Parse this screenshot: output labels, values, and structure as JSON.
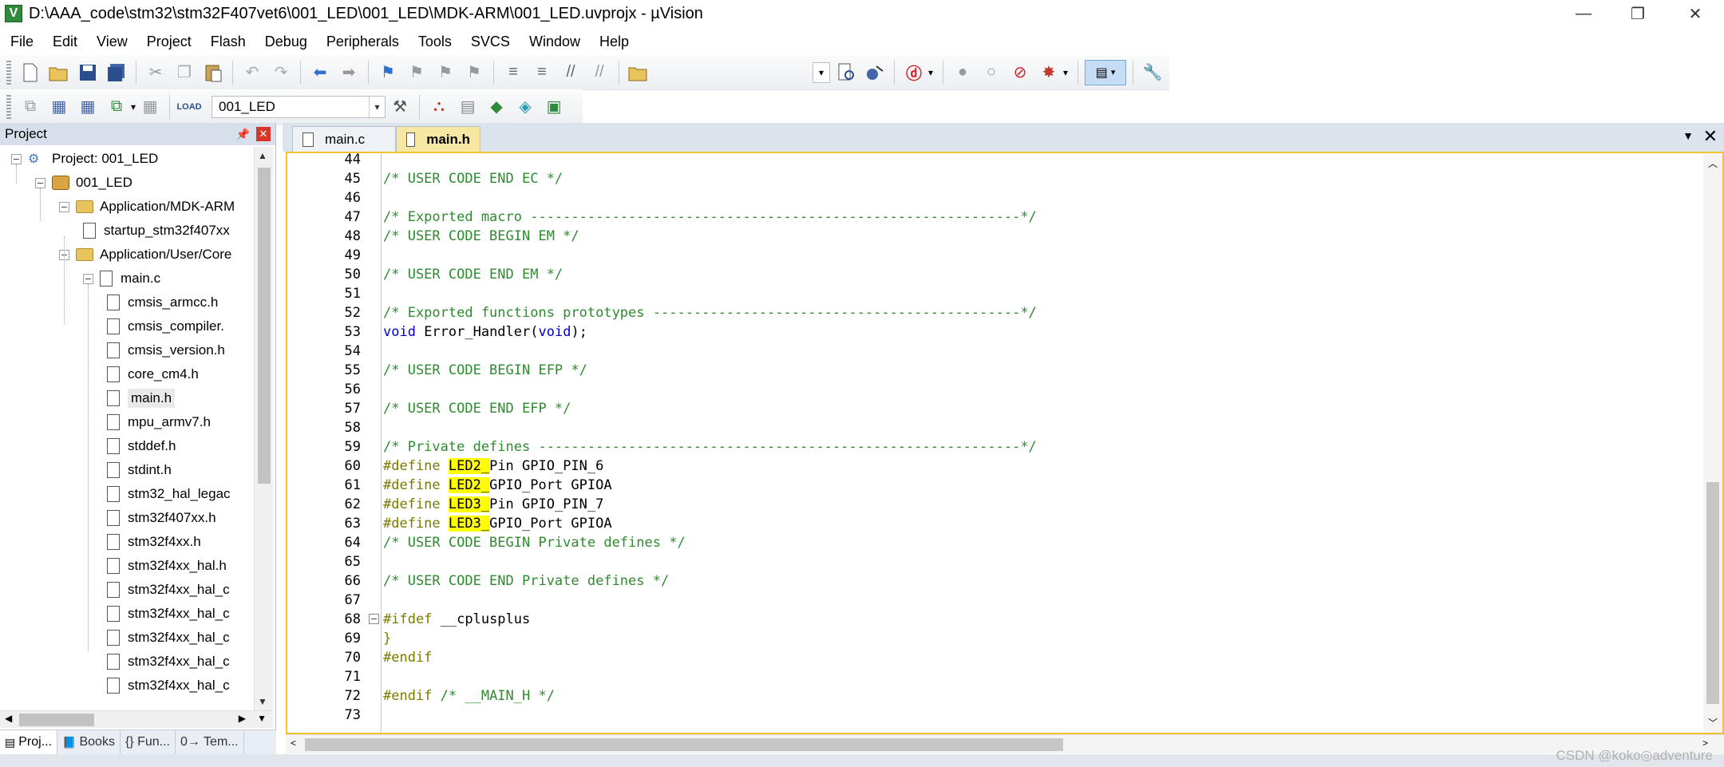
{
  "window": {
    "title": "D:\\AAA_code\\stm32\\stm32F407vet6\\001_LED\\001_LED\\MDK-ARM\\001_LED.uvprojx - µVision",
    "app_icon": "V",
    "controls": {
      "minimize": "—",
      "restore": "❐",
      "close": "✕"
    }
  },
  "menu": [
    "File",
    "Edit",
    "View",
    "Project",
    "Flash",
    "Debug",
    "Peripherals",
    "Tools",
    "SVCS",
    "Window",
    "Help"
  ],
  "toolbar2": {
    "target": "001_LED"
  },
  "project_panel": {
    "title": "Project",
    "tree": [
      {
        "label": "Project: 001_LED",
        "icon": "project-icon",
        "level": 0,
        "toggle": "−"
      },
      {
        "label": "001_LED",
        "icon": "target-icon",
        "level": 1,
        "toggle": "−"
      },
      {
        "label": "Application/MDK-ARM",
        "icon": "folder-icon",
        "level": 2,
        "toggle": "−"
      },
      {
        "label": "startup_stm32f407xx",
        "icon": "file-icon",
        "level": 3,
        "toggle": ""
      },
      {
        "label": "Application/User/Core",
        "icon": "folder-icon",
        "level": 2,
        "toggle": "−"
      },
      {
        "label": "main.c",
        "icon": "file-icon",
        "level": 3,
        "toggle": "−"
      },
      {
        "label": "cmsis_armcc.h",
        "icon": "file-icon",
        "level": 4,
        "toggle": ""
      },
      {
        "label": "cmsis_compiler.",
        "icon": "file-icon",
        "level": 4,
        "toggle": ""
      },
      {
        "label": "cmsis_version.h",
        "icon": "file-icon",
        "level": 4,
        "toggle": ""
      },
      {
        "label": "core_cm4.h",
        "icon": "file-icon",
        "level": 4,
        "toggle": ""
      },
      {
        "label": "main.h",
        "icon": "file-icon",
        "level": 4,
        "toggle": "",
        "selected": true
      },
      {
        "label": "mpu_armv7.h",
        "icon": "file-icon",
        "level": 4,
        "toggle": ""
      },
      {
        "label": "stddef.h",
        "icon": "file-icon",
        "level": 4,
        "toggle": ""
      },
      {
        "label": "stdint.h",
        "icon": "file-icon",
        "level": 4,
        "toggle": ""
      },
      {
        "label": "stm32_hal_legac",
        "icon": "file-icon",
        "level": 4,
        "toggle": ""
      },
      {
        "label": "stm32f407xx.h",
        "icon": "file-icon",
        "level": 4,
        "toggle": ""
      },
      {
        "label": "stm32f4xx.h",
        "icon": "file-icon",
        "level": 4,
        "toggle": ""
      },
      {
        "label": "stm32f4xx_hal.h",
        "icon": "file-icon",
        "level": 4,
        "toggle": ""
      },
      {
        "label": "stm32f4xx_hal_c",
        "icon": "file-icon",
        "level": 4,
        "toggle": ""
      },
      {
        "label": "stm32f4xx_hal_c",
        "icon": "file-icon",
        "level": 4,
        "toggle": ""
      },
      {
        "label": "stm32f4xx_hal_c",
        "icon": "file-icon",
        "level": 4,
        "toggle": ""
      },
      {
        "label": "stm32f4xx_hal_c",
        "icon": "file-icon",
        "level": 4,
        "toggle": ""
      },
      {
        "label": "stm32f4xx_hal_c",
        "icon": "file-icon",
        "level": 4,
        "toggle": ""
      }
    ],
    "bottom_tabs": [
      {
        "label": "Proj...",
        "icon": "project-tab-icon",
        "active": true
      },
      {
        "label": "Books",
        "icon": "books-icon"
      },
      {
        "label": "{} Fun...",
        "icon": "functions-icon"
      },
      {
        "label": "0→ Tem...",
        "icon": "templates-icon"
      }
    ]
  },
  "editor": {
    "tabs": [
      {
        "label": "main.c",
        "active": false
      },
      {
        "label": "main.h",
        "active": true
      }
    ],
    "lines": [
      {
        "n": "44",
        "parts": []
      },
      {
        "n": "45",
        "parts": [
          {
            "t": "/* USER CODE END EC */",
            "c": "comment"
          }
        ]
      },
      {
        "n": "46",
        "parts": []
      },
      {
        "n": "47",
        "parts": [
          {
            "t": "/* Exported macro ------------------------------------------------------------*/",
            "c": "comment"
          }
        ]
      },
      {
        "n": "48",
        "parts": [
          {
            "t": "/* USER CODE BEGIN EM */",
            "c": "comment"
          }
        ]
      },
      {
        "n": "49",
        "parts": []
      },
      {
        "n": "50",
        "parts": [
          {
            "t": "/* USER CODE END EM */",
            "c": "comment"
          }
        ]
      },
      {
        "n": "51",
        "parts": []
      },
      {
        "n": "52",
        "parts": [
          {
            "t": "/* Exported functions prototypes ---------------------------------------------*/",
            "c": "comment"
          }
        ]
      },
      {
        "n": "53",
        "parts": [
          {
            "t": "void",
            "c": "kw"
          },
          {
            "t": " Error_Handler(",
            "c": "id"
          },
          {
            "t": "void",
            "c": "kw"
          },
          {
            "t": ");",
            "c": "id"
          }
        ]
      },
      {
        "n": "54",
        "parts": []
      },
      {
        "n": "55",
        "parts": [
          {
            "t": "/* USER CODE BEGIN EFP */",
            "c": "comment"
          }
        ]
      },
      {
        "n": "56",
        "parts": []
      },
      {
        "n": "57",
        "parts": [
          {
            "t": "/* USER CODE END EFP */",
            "c": "comment"
          }
        ]
      },
      {
        "n": "58",
        "parts": []
      },
      {
        "n": "59",
        "parts": [
          {
            "t": "/* Private defines -----------------------------------------------------------*/",
            "c": "comment"
          }
        ]
      },
      {
        "n": "60",
        "parts": [
          {
            "t": "#define ",
            "c": "pp"
          },
          {
            "t": "LED2_",
            "c": "hl"
          },
          {
            "t": "Pin GPIO_PIN_6",
            "c": "id"
          }
        ]
      },
      {
        "n": "61",
        "parts": [
          {
            "t": "#define ",
            "c": "pp"
          },
          {
            "t": "LED2_",
            "c": "hl"
          },
          {
            "t": "GPIO_Port GPIOA",
            "c": "id"
          }
        ]
      },
      {
        "n": "62",
        "parts": [
          {
            "t": "#define ",
            "c": "pp"
          },
          {
            "t": "LED3_",
            "c": "hl"
          },
          {
            "t": "Pin GPIO_PIN_7",
            "c": "id"
          }
        ]
      },
      {
        "n": "63",
        "parts": [
          {
            "t": "#define ",
            "c": "pp"
          },
          {
            "t": "LED3_",
            "c": "hl"
          },
          {
            "t": "GPIO_Port GPIOA",
            "c": "id"
          }
        ]
      },
      {
        "n": "64",
        "parts": [
          {
            "t": "/* USER CODE BEGIN Private defines */",
            "c": "comment"
          }
        ]
      },
      {
        "n": "65",
        "parts": []
      },
      {
        "n": "66",
        "parts": [
          {
            "t": "/* USER CODE END Private defines */",
            "c": "comment"
          }
        ]
      },
      {
        "n": "67",
        "parts": []
      },
      {
        "n": "68",
        "parts": [
          {
            "t": "#ifdef",
            "c": "pp"
          },
          {
            "t": " __cplusplus",
            "c": "id"
          }
        ],
        "fold": "−"
      },
      {
        "n": "69",
        "parts": [
          {
            "t": "}",
            "c": "pp"
          }
        ]
      },
      {
        "n": "70",
        "parts": [
          {
            "t": "#endif",
            "c": "pp"
          }
        ]
      },
      {
        "n": "71",
        "parts": []
      },
      {
        "n": "72",
        "parts": [
          {
            "t": "#endif",
            "c": "pp"
          },
          {
            "t": " /* __MAIN_H */",
            "c": "comment"
          }
        ]
      },
      {
        "n": "73",
        "parts": []
      }
    ]
  },
  "watermark": "CSDN @koko◎adventure",
  "colors": {
    "comment": "#2e8b2e",
    "preprocessor": "#7a7a00",
    "keyword": "#0000c8",
    "highlight": "#ffff00",
    "active_tab": "#f6e8a2",
    "frame": "#f1c232"
  }
}
